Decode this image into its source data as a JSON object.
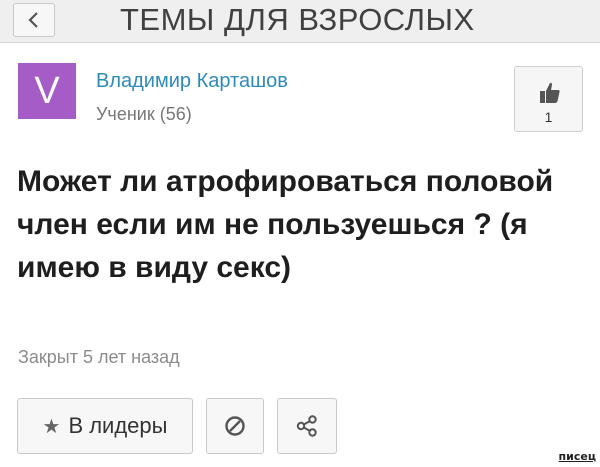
{
  "header": {
    "back_icon": "chevron-left-icon",
    "title": "ТЕМЫ ДЛЯ ВЗРОСЛЫХ"
  },
  "author": {
    "avatar_letter": "V",
    "avatar_color": "#a65cc7",
    "name": "Владимир Карташов",
    "rank": "Ученик (56)"
  },
  "like": {
    "icon": "thumbs-up-icon",
    "count": "1"
  },
  "question": {
    "title": "Может ли атрофироваться половой член если им не пользуешься ? (я имею в виду секс)",
    "closed": "Закрыт 5 лет назад"
  },
  "actions": {
    "leaders_icon": "star-icon",
    "leaders_label": "В лидеры",
    "block_icon": "block-icon",
    "share_icon": "share-icon"
  },
  "watermark": "писец"
}
